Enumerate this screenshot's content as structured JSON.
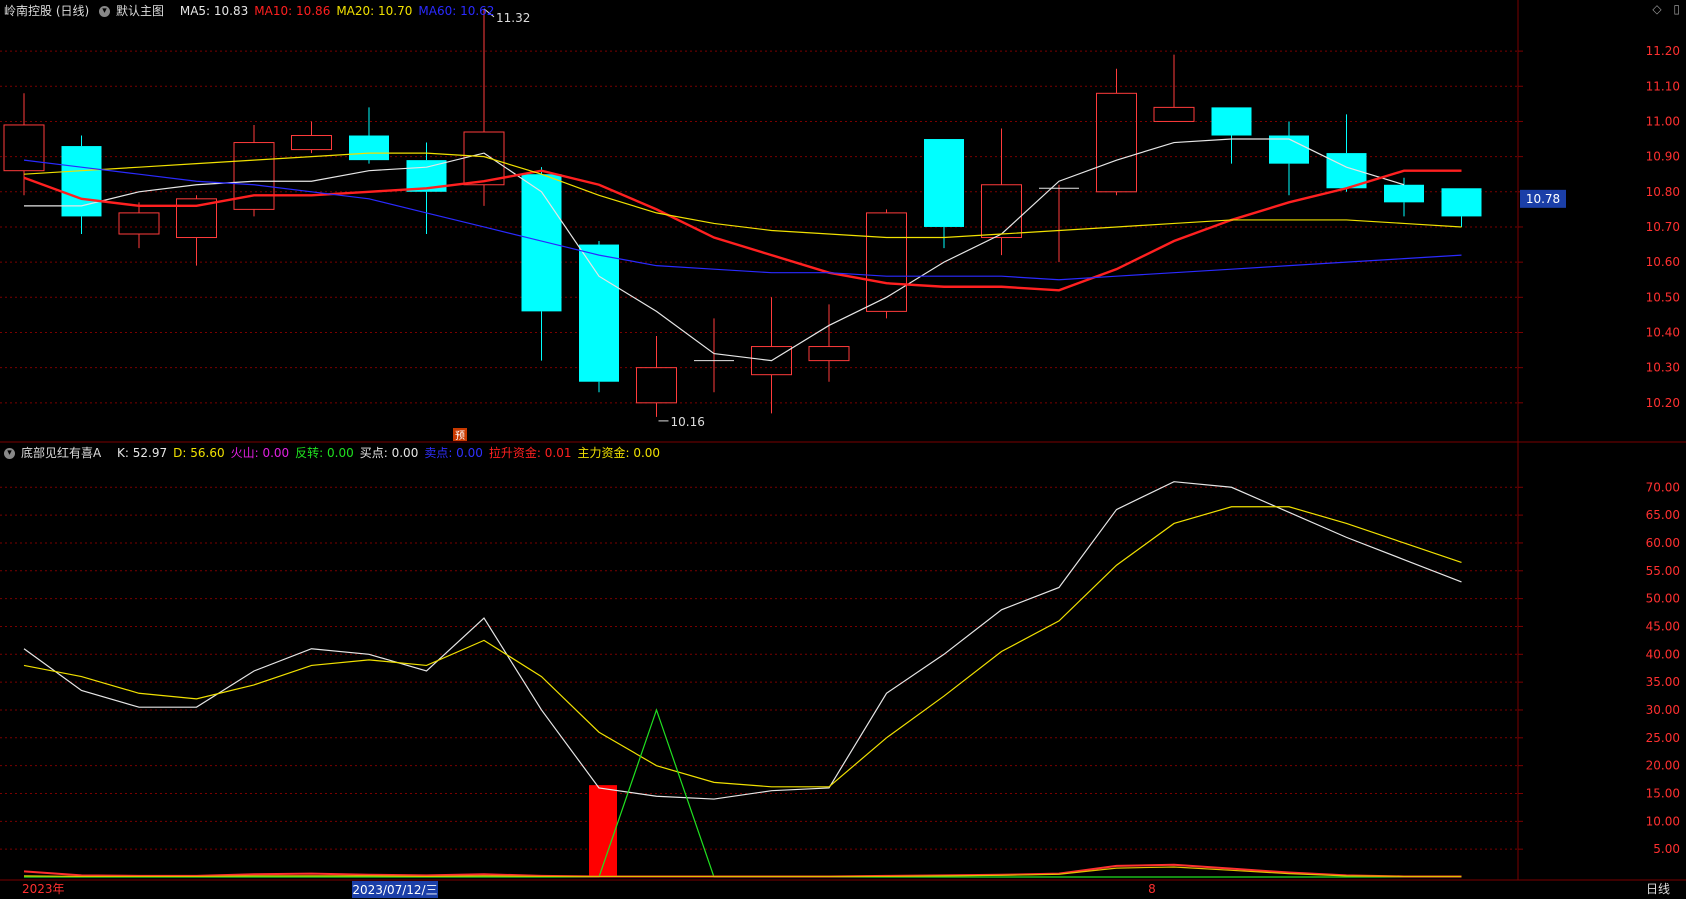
{
  "header": {
    "title": "岭南控股 (日线)",
    "template": "默认主图",
    "ma_items": [
      {
        "label": "MA5: 10.83",
        "color": "#e6e6e6"
      },
      {
        "label": "MA10: 10.86",
        "color": "#ff2020"
      },
      {
        "label": "MA20: 10.70",
        "color": "#f0e000"
      },
      {
        "label": "MA60: 10.62",
        "color": "#2a2aff"
      }
    ]
  },
  "indicator_header": {
    "name": "底部见红有喜A",
    "items": [
      {
        "label": "K: 52.97",
        "color": "#e6e6e6"
      },
      {
        "label": "D: 56.60",
        "color": "#f0e000"
      },
      {
        "label": "火山: 0.00",
        "color": "#e020e0"
      },
      {
        "label": "反转: 0.00",
        "color": "#20e020"
      },
      {
        "label": "买点: 0.00",
        "color": "#e6e6e6"
      },
      {
        "label": "卖点: 0.00",
        "color": "#3030ff"
      },
      {
        "label": "拉升资金: 0.01",
        "color": "#ff2020"
      },
      {
        "label": "主力资金: 0.00",
        "color": "#f0e000"
      }
    ]
  },
  "bottom_bar": {
    "year_label": "2023年",
    "cursor_date": "2023/07/12/三",
    "month_label": "8",
    "period_button": "日线"
  },
  "colors": {
    "up": "#ff3b3b",
    "down": "#00ffff",
    "grid": "#7a0000",
    "axis_text": "#ff3030",
    "ma5": "#e6e6e6",
    "ma10": "#ff2020",
    "ma20": "#f0e000",
    "ma60": "#2a2aff",
    "k": "#e6e6e6",
    "d": "#f0e000"
  },
  "chart_data": [
    {
      "type": "candlestick",
      "yticks": [
        "11.20",
        "11.10",
        "11.00",
        "10.90",
        "10.80",
        "10.70",
        "10.60",
        "10.50",
        "10.40",
        "10.30",
        "10.20"
      ],
      "ylim": [
        10.1,
        11.26
      ],
      "current_price_label": "10.78",
      "current_price": 10.78,
      "high_label": "11.32",
      "high_value": 11.32,
      "low_label": "10.16",
      "low_value": 10.16,
      "marker_label": "预",
      "candles": [
        {
          "o": 10.86,
          "c": 10.99,
          "h": 11.08,
          "l": 10.79
        },
        {
          "o": 10.93,
          "c": 10.73,
          "h": 10.96,
          "l": 10.68
        },
        {
          "o": 10.68,
          "c": 10.74,
          "h": 10.77,
          "l": 10.64
        },
        {
          "o": 10.67,
          "c": 10.78,
          "h": 10.79,
          "l": 10.59
        },
        {
          "o": 10.75,
          "c": 10.94,
          "h": 10.99,
          "l": 10.73
        },
        {
          "o": 10.92,
          "c": 10.96,
          "h": 11.0,
          "l": 10.91
        },
        {
          "o": 10.96,
          "c": 10.89,
          "h": 11.04,
          "l": 10.88
        },
        {
          "o": 10.89,
          "c": 10.8,
          "h": 10.94,
          "l": 10.68
        },
        {
          "o": 10.82,
          "c": 10.97,
          "h": 11.32,
          "l": 10.76
        },
        {
          "o": 10.85,
          "c": 10.46,
          "h": 10.87,
          "l": 10.32
        },
        {
          "o": 10.65,
          "c": 10.26,
          "h": 10.66,
          "l": 10.23
        },
        {
          "o": 10.2,
          "c": 10.3,
          "h": 10.39,
          "l": 10.16
        },
        {
          "o": 10.32,
          "c": 10.32,
          "h": 10.44,
          "l": 10.23
        },
        {
          "o": 10.28,
          "c": 10.36,
          "h": 10.5,
          "l": 10.17
        },
        {
          "o": 10.32,
          "c": 10.36,
          "h": 10.48,
          "l": 10.26
        },
        {
          "o": 10.46,
          "c": 10.74,
          "h": 10.75,
          "l": 10.44
        },
        {
          "o": 10.95,
          "c": 10.7,
          "h": 10.95,
          "l": 10.64
        },
        {
          "o": 10.67,
          "c": 10.82,
          "h": 10.98,
          "l": 10.62
        },
        {
          "o": 10.81,
          "c": 10.81,
          "h": 10.82,
          "l": 10.6
        },
        {
          "o": 10.8,
          "c": 11.08,
          "h": 11.15,
          "l": 10.79
        },
        {
          "o": 11.0,
          "c": 11.04,
          "h": 11.19,
          "l": 11.0
        },
        {
          "o": 11.04,
          "c": 10.96,
          "h": 11.04,
          "l": 10.88
        },
        {
          "o": 10.96,
          "c": 10.88,
          "h": 11.0,
          "l": 10.79
        },
        {
          "o": 10.91,
          "c": 10.81,
          "h": 11.02,
          "l": 10.8
        },
        {
          "o": 10.82,
          "c": 10.77,
          "h": 10.84,
          "l": 10.73
        },
        {
          "o": 10.81,
          "c": 10.73,
          "h": 10.81,
          "l": 10.7
        }
      ],
      "series": [
        {
          "name": "MA5",
          "values": [
            10.76,
            10.76,
            10.8,
            10.82,
            10.83,
            10.83,
            10.86,
            10.87,
            10.91,
            10.8,
            10.56,
            10.46,
            10.34,
            10.32,
            10.42,
            10.5,
            10.6,
            10.68,
            10.83,
            10.89,
            10.94,
            10.95,
            10.95,
            10.87,
            10.82
          ]
        },
        {
          "name": "MA10",
          "values": [
            10.84,
            10.78,
            10.76,
            10.76,
            10.79,
            10.79,
            10.8,
            10.81,
            10.83,
            10.86,
            10.82,
            10.75,
            10.67,
            10.62,
            10.57,
            10.54,
            10.53,
            10.53,
            10.52,
            10.58,
            10.66,
            10.72,
            10.77,
            10.81,
            10.86,
            10.86
          ]
        },
        {
          "name": "MA20",
          "values": [
            10.85,
            10.86,
            10.87,
            10.88,
            10.89,
            10.9,
            10.91,
            10.91,
            10.9,
            10.85,
            10.79,
            10.74,
            10.71,
            10.69,
            10.68,
            10.67,
            10.67,
            10.68,
            10.69,
            10.7,
            10.71,
            10.72,
            10.72,
            10.72,
            10.71,
            10.7
          ]
        },
        {
          "name": "MA60",
          "values": [
            10.89,
            10.87,
            10.85,
            10.83,
            10.82,
            10.8,
            10.78,
            10.74,
            10.7,
            10.66,
            10.62,
            10.59,
            10.58,
            10.57,
            10.57,
            10.56,
            10.56,
            10.56,
            10.55,
            10.56,
            10.57,
            10.58,
            10.59,
            10.6,
            10.61,
            10.62
          ]
        }
      ]
    },
    {
      "type": "line",
      "title": "底部见红有喜A",
      "yticks": [
        "70.00",
        "65.00",
        "60.00",
        "55.00",
        "50.00",
        "45.00",
        "40.00",
        "35.00",
        "30.00",
        "25.00",
        "20.00",
        "15.00",
        "10.00",
        "5.00"
      ],
      "ylim": [
        0,
        74
      ],
      "series": [
        {
          "name": "K",
          "values": [
            41,
            33.5,
            30.5,
            30.5,
            37,
            41,
            40,
            37,
            46.5,
            30,
            16,
            14.5,
            14,
            15.5,
            16,
            33,
            40,
            48,
            52,
            66,
            71,
            70,
            65.5,
            61,
            57,
            53
          ]
        },
        {
          "name": "D",
          "values": [
            38,
            36,
            33,
            32,
            34.5,
            38,
            39,
            38,
            42.5,
            36,
            26,
            20,
            17,
            16.2,
            16.2,
            25,
            32.5,
            40.5,
            46,
            56,
            63.5,
            66.5,
            66.5,
            63.5,
            60,
            56.5
          ]
        },
        {
          "name": "反转",
          "values": [
            0,
            0,
            0,
            0,
            0,
            0,
            0,
            0,
            0,
            0,
            0,
            30,
            0,
            0,
            0,
            0,
            0,
            0,
            0,
            0,
            0,
            0,
            0,
            0,
            0,
            0
          ]
        },
        {
          "name": "拉升资金",
          "values": [
            1,
            0.3,
            0.2,
            0.2,
            0.5,
            0.6,
            0.4,
            0.3,
            0.5,
            0.2,
            0.1,
            0.1,
            0.1,
            0.1,
            0.1,
            0.2,
            0.3,
            0.4,
            0.6,
            2,
            2.2,
            1.5,
            0.8,
            0.3,
            0.1,
            0.1
          ]
        },
        {
          "name": "主力资金",
          "values": [
            0.2,
            0.1,
            0.1,
            0.1,
            0.2,
            0.2,
            0.2,
            0.1,
            0.2,
            0.1,
            0.1,
            0.1,
            0.1,
            0.1,
            0.1,
            0.1,
            0.2,
            0.3,
            0.5,
            1.6,
            1.8,
            1.2,
            0.6,
            0.2,
            0.1,
            0.1
          ]
        }
      ],
      "bars": [
        {
          "name": "买点",
          "index": 10,
          "value": 16.5
        }
      ]
    }
  ]
}
